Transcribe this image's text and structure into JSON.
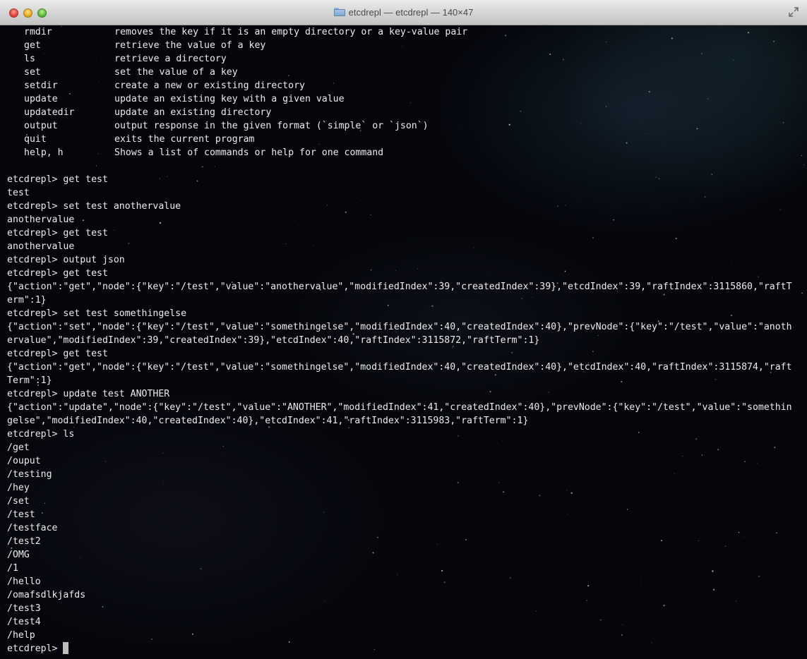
{
  "window": {
    "title": "etcdrepl — etcdrepl — 140×47"
  },
  "help_commands": [
    {
      "name": "rmdir",
      "desc": "removes the key if it is an empty directory or a key-value pair"
    },
    {
      "name": "get",
      "desc": "retrieve the value of a key"
    },
    {
      "name": "ls",
      "desc": "retrieve a directory"
    },
    {
      "name": "set",
      "desc": "set the value of a key"
    },
    {
      "name": "setdir",
      "desc": "create a new or existing directory"
    },
    {
      "name": "update",
      "desc": "update an existing key with a given value"
    },
    {
      "name": "updatedir",
      "desc": "update an existing directory"
    },
    {
      "name": "output",
      "desc": "output response in the given format (`simple` or `json`)"
    },
    {
      "name": "quit",
      "desc": "exits the current program"
    },
    {
      "name": "help, h",
      "desc": "Shows a list of commands or help for one command"
    }
  ],
  "session_lines": [
    "",
    "etcdrepl> get test",
    "test",
    "etcdrepl> set test anothervalue",
    "anothervalue",
    "etcdrepl> get test",
    "anothervalue",
    "etcdrepl> output json",
    "etcdrepl> get test",
    "{\"action\":\"get\",\"node\":{\"key\":\"/test\",\"value\":\"anothervalue\",\"modifiedIndex\":39,\"createdIndex\":39},\"etcdIndex\":39,\"raftIndex\":3115860,\"raftT",
    "erm\":1}",
    "etcdrepl> set test somethingelse",
    "{\"action\":\"set\",\"node\":{\"key\":\"/test\",\"value\":\"somethingelse\",\"modifiedIndex\":40,\"createdIndex\":40},\"prevNode\":{\"key\":\"/test\",\"value\":\"anoth",
    "ervalue\",\"modifiedIndex\":39,\"createdIndex\":39},\"etcdIndex\":40,\"raftIndex\":3115872,\"raftTerm\":1}",
    "etcdrepl> get test",
    "{\"action\":\"get\",\"node\":{\"key\":\"/test\",\"value\":\"somethingelse\",\"modifiedIndex\":40,\"createdIndex\":40},\"etcdIndex\":40,\"raftIndex\":3115874,\"raft",
    "Term\":1}",
    "etcdrepl> update test ANOTHER",
    "{\"action\":\"update\",\"node\":{\"key\":\"/test\",\"value\":\"ANOTHER\",\"modifiedIndex\":41,\"createdIndex\":40},\"prevNode\":{\"key\":\"/test\",\"value\":\"somethin",
    "gelse\",\"modifiedIndex\":40,\"createdIndex\":40},\"etcdIndex\":41,\"raftIndex\":3115983,\"raftTerm\":1}",
    "etcdrepl> ls",
    "/get",
    "/ouput",
    "/testing",
    "/hey",
    "/set",
    "/test",
    "/testface",
    "/test2",
    "/OMG",
    "/1",
    "/hello",
    "/omafsdlkjafds",
    "/test3",
    "/test4",
    "/help"
  ],
  "prompt": {
    "text": "etcdrepl> "
  },
  "colors": {
    "text": "#ececec",
    "background": "#04060b",
    "cursor": "#bdbdbd"
  }
}
